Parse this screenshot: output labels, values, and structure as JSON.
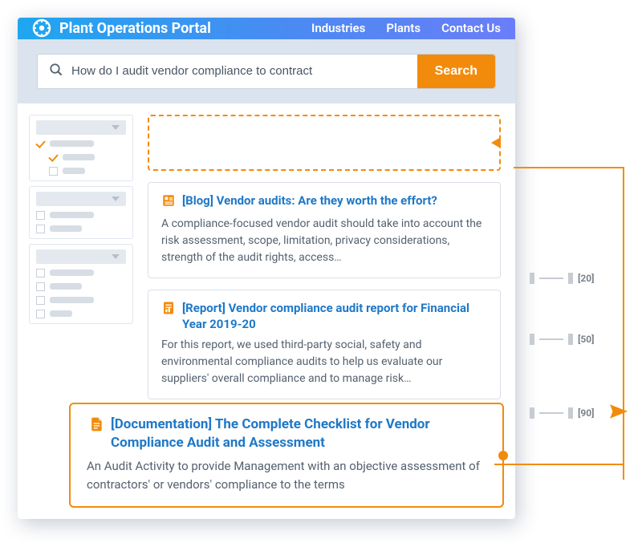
{
  "header": {
    "brand": "Plant Operations Portal",
    "nav": [
      "Industries",
      "Plants",
      "Contact Us"
    ]
  },
  "search": {
    "value": "How do I audit vendor compliance to contract",
    "button": "Search"
  },
  "results": [
    {
      "icon": "grid",
      "title": "[Blog] Vendor audits: Are they worth the effort?",
      "body": "A compliance-focused vendor audit should take into account the risk assessment, scope, limitation, privacy considerations, strength of the audit rights, access…"
    },
    {
      "icon": "report",
      "title": "[Report] Vendor compliance audit report for Financial Year 2019-20",
      "body": "For this report, we used third-party social, safety and environmental compliance audits to help us evaluate our suppliers' overall compliance and to manage risk…"
    }
  ],
  "featured": {
    "title": "[Documentation] The Complete Checklist for Vendor Compliance Audit and Assessment",
    "body": "An Audit Activity to provide Management with an objective assessment of contractors' or vendors' compliance to the terms"
  },
  "scale": {
    "ticks": [
      "[20]",
      "[50]",
      "[90]"
    ]
  }
}
